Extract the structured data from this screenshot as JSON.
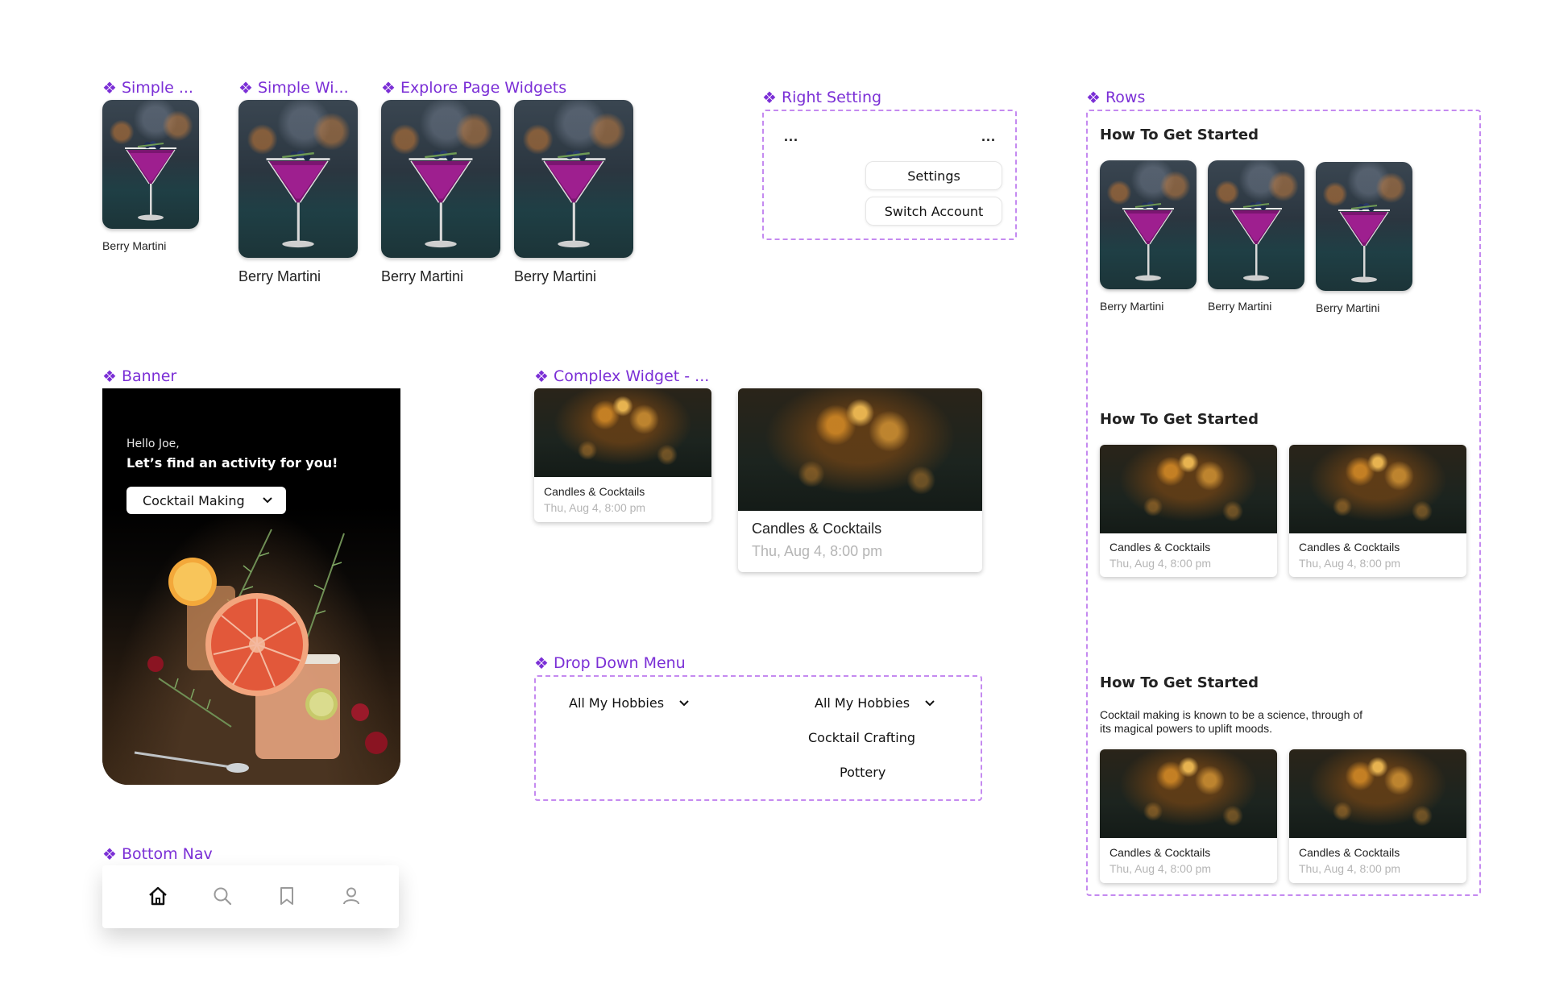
{
  "labels": {
    "simple_1": "Simple ...",
    "simple_2": "Simple Wi...",
    "explore": "Explore Page Widgets",
    "right_setting": "Right Setting",
    "rows": "Rows",
    "banner": "Banner",
    "complex": "Complex Widget - ...",
    "dropdown": "Drop Down Menu",
    "bottom_nav": "Bottom Nav"
  },
  "martini_caption": "Berry Martini",
  "right_setting": {
    "more_left": "...",
    "more_right": "...",
    "settings": "Settings",
    "switch_account": "Switch Account"
  },
  "banner": {
    "greeting": "Hello Joe,",
    "headline": "Let’s find an activity for you!",
    "selected": "Cocktail Making"
  },
  "event": {
    "title": "Candles & Cocktails",
    "date": "Thu, Aug 4, 8:00 pm"
  },
  "dropdown": {
    "selected_a": "All My Hobbies",
    "selected_b": "All My Hobbies",
    "options": [
      "Cocktail Crafting",
      "Pottery"
    ]
  },
  "rows": {
    "heading_1": "How To Get Started",
    "heading_2": "How To Get Started",
    "heading_3": "How To Get Started",
    "description": "Cocktail making is known to be a science, through of its magical powers to uplift moods."
  },
  "bottom_nav": {
    "icons": [
      "home-icon",
      "search-icon",
      "bookmark-icon",
      "profile-icon"
    ]
  },
  "colors": {
    "accent": "#7b2fd6",
    "dashed_border": "#c58af0",
    "muted_text": "#b5b5b5"
  }
}
